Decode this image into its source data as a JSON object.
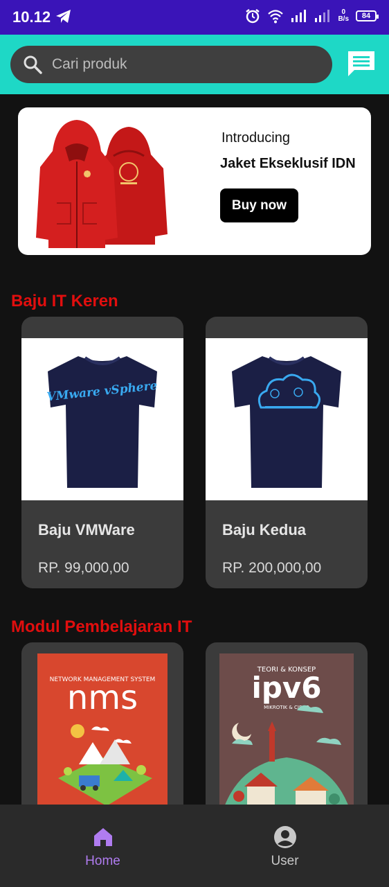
{
  "status_bar": {
    "time": "10.12",
    "net_speed_value": "0",
    "net_speed_unit": "B/s",
    "battery": "84",
    "icons": [
      "telegram-icon",
      "alarm-icon",
      "wifi-icon",
      "signal-icon",
      "signal-icon",
      "battery-icon"
    ]
  },
  "search": {
    "placeholder": "Cari produk",
    "value": ""
  },
  "theme": {
    "status_bar_bg": "#3a14b8",
    "header_bg": "#1ed8c6",
    "section_title_color": "#e10e0e",
    "nav_active_color": "#b07cf0"
  },
  "banner": {
    "intro": "Introducing",
    "title": "Jaket Ekseklusif IDN",
    "button": "Buy now"
  },
  "sections": [
    {
      "title": "Baju IT Keren",
      "products": [
        {
          "name": "Baju VMWare",
          "price": "RP. 99,000,00",
          "print_text": "VMware vSphere"
        },
        {
          "name": "Baju Kedua",
          "price": "RP. 200,000,00"
        }
      ]
    },
    {
      "title": "Modul Pembelajaran IT",
      "books": [
        {
          "top_text": "NETWORK MANAGEMENT SYSTEM",
          "title": "nms"
        },
        {
          "top_text": "TEORI & KONSEP",
          "title": "ipv6",
          "subtitle": "MIKROTIK & CISCO"
        }
      ]
    }
  ],
  "bottom_nav": {
    "items": [
      {
        "label": "Home",
        "icon": "home-icon",
        "active": true
      },
      {
        "label": "User",
        "icon": "user-icon",
        "active": false
      }
    ]
  }
}
